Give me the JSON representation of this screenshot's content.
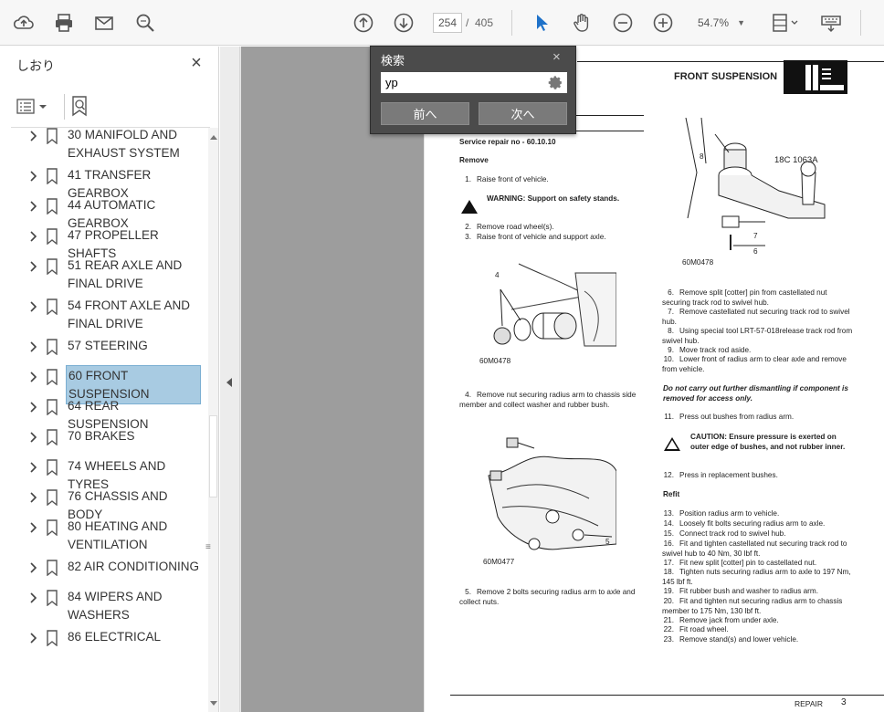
{
  "toolbar": {
    "page_current": "254",
    "page_separator": "/",
    "page_total": "405",
    "zoom": "54.7%"
  },
  "sidebar": {
    "title": "しおり",
    "close": "×",
    "items": [
      {
        "label": "30  MANIFOLD AND EXHAUST SYSTEM"
      },
      {
        "label": "41  TRANSFER GEARBOX"
      },
      {
        "label": "44  AUTOMATIC GEARBOX"
      },
      {
        "label": "47  PROPELLER SHAFTS"
      },
      {
        "label": "51  REAR AXLE AND FINAL DRIVE"
      },
      {
        "label": "54  FRONT AXLE AND FINAL DRIVE"
      },
      {
        "label": "57  STEERING"
      },
      {
        "label": "60  FRONT SUSPENSION",
        "selected": true
      },
      {
        "label": "64  REAR SUSPENSION"
      },
      {
        "label": "70  BRAKES"
      },
      {
        "label": "74  WHEELS AND TYRES"
      },
      {
        "label": "76  CHASSIS AND BODY"
      },
      {
        "label": "80  HEATING AND VENTILATION"
      },
      {
        "label": "82  AIR CONDITIONING"
      },
      {
        "label": "84  WIPERS AND WASHERS"
      },
      {
        "label": "86  ELECTRICAL"
      }
    ]
  },
  "search": {
    "title": "検索",
    "close": "×",
    "value": "yp",
    "prev_label": "前へ",
    "next_label": "次へ"
  },
  "doc": {
    "header_title": "FRONT SUSPENSION",
    "service_repair": "Service repair no - 60.10.10",
    "remove_heading": "Remove",
    "step1": "Raise front of vehicle.",
    "warning1": "WARNING: Support on safety stands.",
    "step2": "Remove road wheel(s).",
    "step3": "Raise front of vehicle and support axle.",
    "fig1_code": "60M0478",
    "fig1_label": "4",
    "step4": "Remove nut securing radius arm to chassis side member and collect washer and rubber bush.",
    "fig2_code": "60M0477",
    "fig2_label": "5",
    "step5": "Remove 2 bolts securing radius arm to axle and collect nuts.",
    "fig3_code": "60M0478",
    "fig3_ref": "18C 1063A",
    "fig3_l6": "6",
    "fig3_l7": "7",
    "fig3_l8": "8",
    "step6": "Remove split [cotter] pin from castellated nut securing track rod to swivel hub.",
    "step7": "Remove castellated nut securing track rod to swivel hub.",
    "step8": "Using special tool LRT-57-018release track rod from swivel hub.",
    "step9": "Move track rod aside.",
    "step10": "Lower front of radius arm to clear axle and remove from vehicle.",
    "note": "Do not carry out further dismantling if component is removed for access only.",
    "step11": "Press out bushes from radius arm.",
    "caution": "CAUTION: Ensure pressure is exerted on outer edge of bushes, and not rubber inner.",
    "step12": "Press in replacement bushes.",
    "refit_heading": "Refit",
    "step13": "Position radius arm to vehicle.",
    "step14": "Loosely fit bolts securing radius arm to axle.",
    "step15": "Connect track rod to swivel hub.",
    "step16": "Fit and tighten castellated nut securing track rod to swivel hub to 40 Nm, 30 lbf ft.",
    "step17": "Fit new split [cotter] pin to castellated nut.",
    "step18": "Tighten nuts securing radius arm to axle to 197 Nm, 145 lbf ft.",
    "step19": "Fit rubber bush and washer to radius arm.",
    "step20": "Fit and tighten nut securing radius arm to chassis member to 175 Nm, 130 lbf ft.",
    "step21": "Remove jack from under axle.",
    "step22": "Fit road wheel.",
    "step23": "Remove stand(s) and lower vehicle.",
    "footer_label": "REPAIR",
    "footer_page": "3"
  }
}
